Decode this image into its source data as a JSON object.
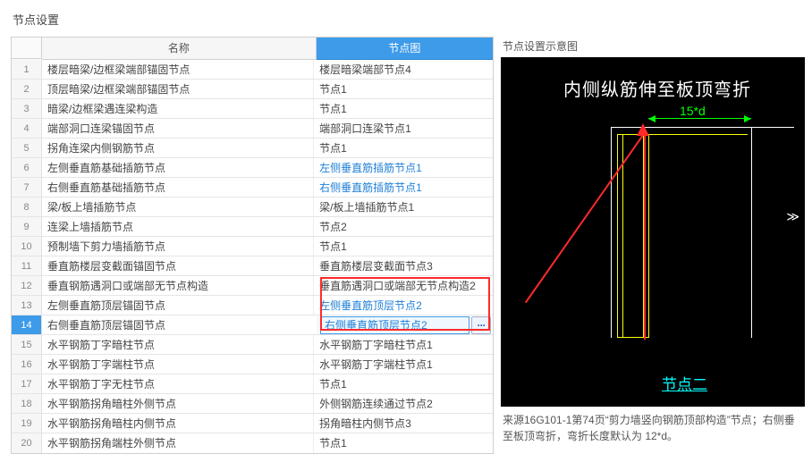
{
  "title": "节点设置",
  "columns": {
    "name": "名称",
    "node": "节点图"
  },
  "rows": [
    {
      "n": 1,
      "name": "楼层暗梁/边框梁端部锚固节点",
      "node": "楼层暗梁端部节点4",
      "link": false
    },
    {
      "n": 2,
      "name": "顶层暗梁/边框梁端部锚固节点",
      "node": "节点1",
      "link": false
    },
    {
      "n": 3,
      "name": "暗梁/边框梁遇连梁构造",
      "node": "节点1",
      "link": false
    },
    {
      "n": 4,
      "name": "端部洞口连梁锚固节点",
      "node": "端部洞口连梁节点1",
      "link": false
    },
    {
      "n": 5,
      "name": "拐角连梁内侧钢筋节点",
      "node": "节点1",
      "link": false
    },
    {
      "n": 6,
      "name": "左侧垂直筋基础插筋节点",
      "node": "左侧垂直筋插筋节点1",
      "link": true
    },
    {
      "n": 7,
      "name": "右侧垂直筋基础插筋节点",
      "node": "右侧垂直筋插筋节点1",
      "link": true
    },
    {
      "n": 8,
      "name": "梁/板上墙插筋节点",
      "node": "梁/板上墙插筋节点1",
      "link": false
    },
    {
      "n": 9,
      "name": "连梁上墙插筋节点",
      "node": "节点2",
      "link": false
    },
    {
      "n": 10,
      "name": "预制墙下剪力墙插筋节点",
      "node": "节点1",
      "link": false
    },
    {
      "n": 11,
      "name": "垂直筋楼层变截面锚固节点",
      "node": "垂直筋楼层变截面节点3",
      "link": false
    },
    {
      "n": 12,
      "name": "垂直钢筋遇洞口或端部无节点构造",
      "node": "垂直筋遇洞口或端部无节点构造2",
      "link": false
    },
    {
      "n": 13,
      "name": "左侧垂直筋顶层锚固节点",
      "node": "左侧垂直筋顶层节点2",
      "link": true
    },
    {
      "n": 14,
      "name": "右侧垂直筋顶层锚固节点",
      "node": "右侧垂直筋顶层节点2",
      "link": true,
      "active": true
    },
    {
      "n": 15,
      "name": "水平钢筋丁字暗柱节点",
      "node": "水平钢筋丁字暗柱节点1",
      "link": false
    },
    {
      "n": 16,
      "name": "水平钢筋丁字端柱节点",
      "node": "水平钢筋丁字端柱节点1",
      "link": false
    },
    {
      "n": 17,
      "name": "水平钢筋丁字无柱节点",
      "node": "节点1",
      "link": false
    },
    {
      "n": 18,
      "name": "水平钢筋拐角暗柱外侧节点",
      "node": "外侧钢筋连续通过节点2",
      "link": false
    },
    {
      "n": 19,
      "name": "水平钢筋拐角暗柱内侧节点",
      "node": "拐角暗柱内侧节点3",
      "link": false
    },
    {
      "n": 20,
      "name": "水平钢筋拐角端柱外侧节点",
      "node": "节点1",
      "link": false
    }
  ],
  "preview": {
    "title": "节点设置示意图",
    "banner": "内侧纵筋伸至板顶弯折",
    "dim": "15*d",
    "label": "节点二"
  },
  "source": "来源16G101-1第74页“剪力墙竖向钢筋顶部构造”节点；右侧垂至板顶弯折，弯折长度默认为 12*d。",
  "editBtn": "···"
}
